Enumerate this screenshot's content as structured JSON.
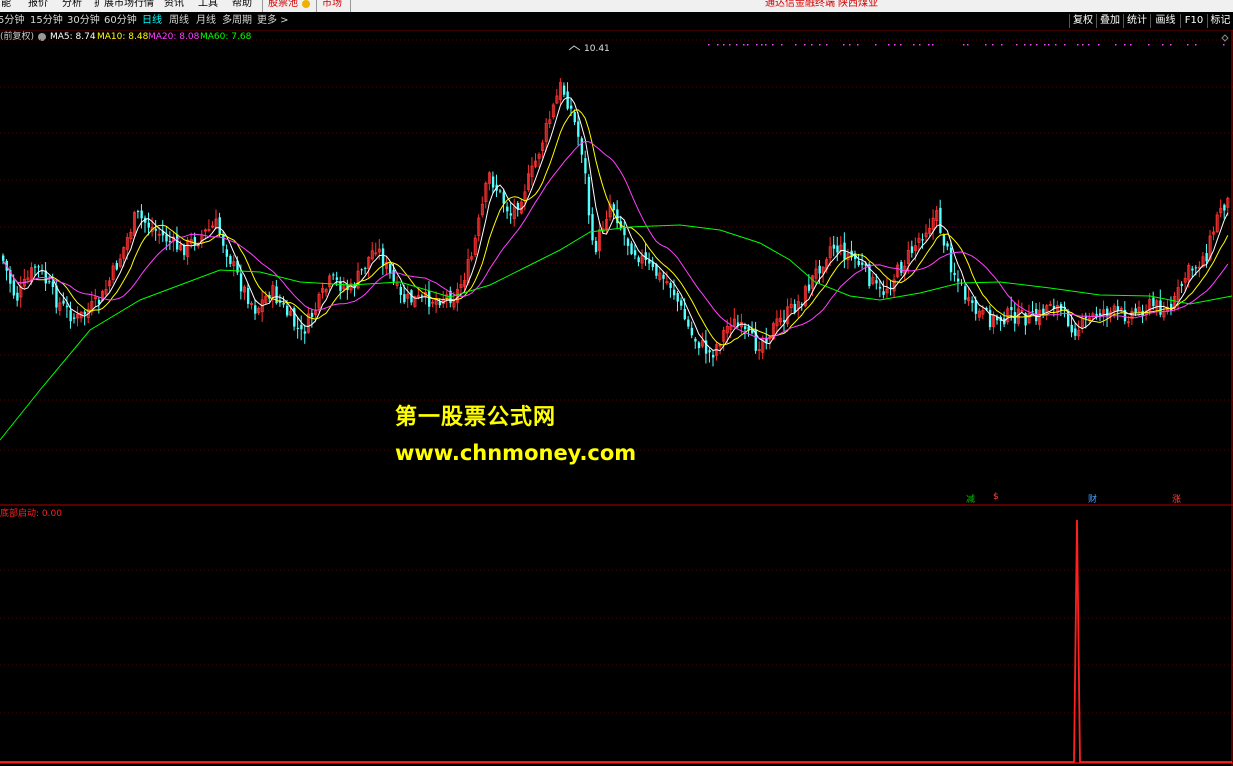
{
  "menubar": {
    "items": [
      "能",
      "报价",
      "分析",
      "扩展市场行情",
      "资讯",
      "工具",
      "帮助",
      "股票池",
      "市场"
    ],
    "ticker": "通达信金融终端",
    "stock_name": "陕西煤业"
  },
  "toolbar": {
    "periods": [
      "5分钟",
      "15分钟",
      "30分钟",
      "60分钟",
      "日线",
      "周线",
      "月线",
      "多周期",
      "更多 >"
    ],
    "active_period": "日线",
    "right_buttons": [
      "复权",
      "叠加",
      "统计",
      "画线",
      "F10",
      "标记"
    ]
  },
  "main_chart": {
    "title": "(前复权)",
    "ma_labels": [
      {
        "label": "MA5: 8.74",
        "color": "#ffffff"
      },
      {
        "label": "MA10: 8.48",
        "color": "#ffff00"
      },
      {
        "label": "MA20: 8.08",
        "color": "#ff40ff"
      },
      {
        "label": "MA60: 7.68",
        "color": "#00ff00"
      }
    ],
    "peak_label": "10.41",
    "markers": [
      {
        "text": "减",
        "color": "#00c000"
      },
      {
        "text": "$",
        "color": "#ff4040"
      },
      {
        "text": "财",
        "color": "#4aa0ff"
      },
      {
        "text": "涨",
        "color": "#ff4040"
      }
    ],
    "up_color": "#ff3232",
    "down_color": "#54ffff",
    "ma_colors": {
      "ma5": "#ffffff",
      "ma10": "#ffff00",
      "ma20": "#ff40ff",
      "ma60": "#00ff00"
    }
  },
  "watermark": {
    "line1": "第一股票公式网",
    "line2": "www.chnmoney.com",
    "color": "#ffff00"
  },
  "indicator": {
    "title": "底部启动: 0.00",
    "color": "#ff2020"
  }
}
